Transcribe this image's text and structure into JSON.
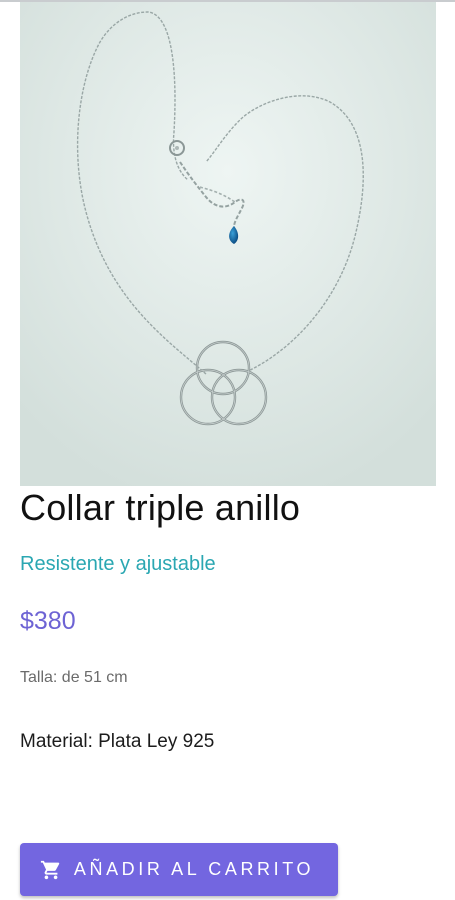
{
  "product": {
    "image_alt": "Collar triple anillo",
    "title": "Collar triple anillo",
    "subtitle": "Resistente y ajustable",
    "price": "$380",
    "size": "Talla: de 51 cm",
    "material": "Material: Plata Ley 925"
  },
  "cart_button": {
    "label": "AÑADIR AL CARRITO",
    "icon": "cart-icon"
  },
  "colors": {
    "accent": "#7366e0",
    "subtitle": "#2aa7b2",
    "price": "#6d63d4"
  }
}
